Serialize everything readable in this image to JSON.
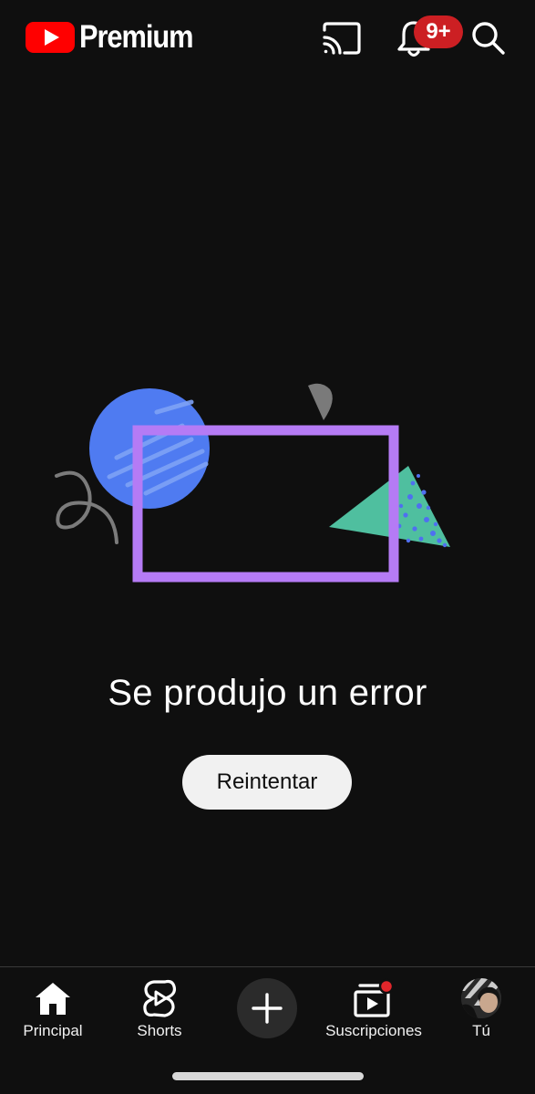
{
  "header": {
    "brand_text": "Premium",
    "notification_count": "9+"
  },
  "icons": {
    "logo": "youtube-play-logo",
    "cast": "cast-icon",
    "notifications": "bell-icon",
    "search": "search-icon"
  },
  "colors": {
    "background": "#0f0f0f",
    "brand_red": "#ff0000",
    "badge_red": "#cc1f23",
    "illustration_frame": "#b57bf5",
    "illustration_circle": "#4f7bf1",
    "illustration_triangle": "#4fbf9f"
  },
  "error": {
    "title": "Se produjo un error",
    "retry_label": "Reintentar"
  },
  "nav": {
    "home_label": "Principal",
    "shorts_label": "Shorts",
    "subscriptions_label": "Suscripciones",
    "you_label": "Tú"
  }
}
